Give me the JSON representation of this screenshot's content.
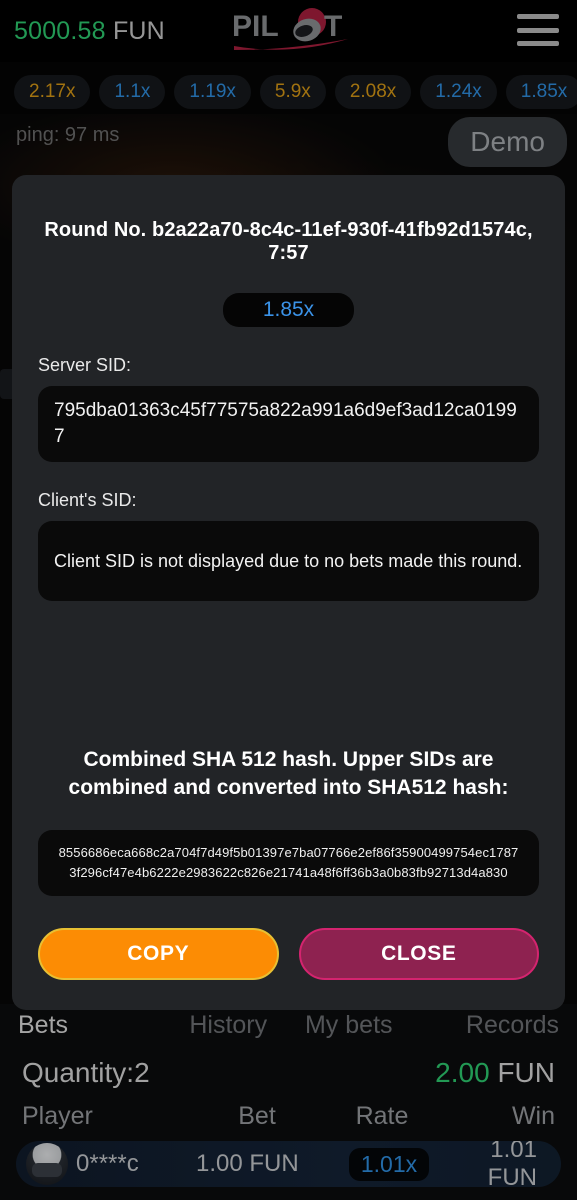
{
  "topbar": {
    "balance_amount": "5000.58",
    "balance_currency": "FUN",
    "logo_text": "PILOT",
    "menu_icon": "hamburger-menu-icon"
  },
  "multiplier_history": [
    {
      "value": "2.17x",
      "color": "gold"
    },
    {
      "value": "1.1x",
      "color": "blue"
    },
    {
      "value": "1.19x",
      "color": "blue"
    },
    {
      "value": "5.9x",
      "color": "gold"
    },
    {
      "value": "2.08x",
      "color": "gold"
    },
    {
      "value": "1.24x",
      "color": "blue"
    },
    {
      "value": "1.85x",
      "color": "blue"
    }
  ],
  "game": {
    "ping": "ping: 97 ms",
    "demo_badge": "Demo"
  },
  "modal": {
    "round_title": "Round No. b2a22a70-8c4c-11ef-930f-41fb92d1574c, 7:57",
    "multiplier": "1.85x",
    "server_sid_label": "Server SID:",
    "server_sid_value": "795dba01363c45f77575a822a991a6d9ef3ad12ca01997",
    "client_sid_label": "Client's SID:",
    "client_sid_value": "Client SID is not displayed due to no bets made this round.",
    "sha_title": "Combined SHA 512 hash. Upper SIDs are combined and converted into SHA512 hash:",
    "sha_hash": "8556686eca668c2a704f7d49f5b01397e7ba07766e2ef86f35900499754ec17873f296cf47e4b6222e2983622c826e21741a48f6ff36b3a0b83fb92713d4a830",
    "copy_label": "COPY",
    "close_label": "CLOSE"
  },
  "bottom": {
    "tabs": [
      {
        "label": "Bets",
        "active": true
      },
      {
        "label": "History",
        "active": false
      },
      {
        "label": "My bets",
        "active": false
      },
      {
        "label": "Records",
        "active": false
      }
    ],
    "quantity_label": "Quantity:",
    "quantity_value": "2",
    "total_amount": "2.00",
    "total_currency": "FUN",
    "columns": {
      "player": "Player",
      "bet": "Bet",
      "rate": "Rate",
      "win": "Win"
    },
    "rows": [
      {
        "player": "0****c",
        "bet": "1.00 FUN",
        "rate": "1.01x",
        "win": "1.01 FUN"
      }
    ]
  },
  "colors": {
    "accent_green": "#2ecc71",
    "accent_blue": "#2f8fe0",
    "accent_gold": "#d99a16",
    "copy_orange": "#fc8c04",
    "close_magenta": "#8e2250",
    "logo_red": "#a81f3e"
  }
}
